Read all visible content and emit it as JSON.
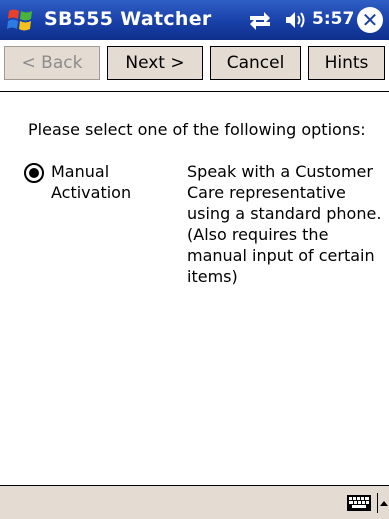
{
  "titlebar": {
    "app_title": "SB555 Watcher",
    "clock": "5:57",
    "close_glyph": "✕",
    "start_icon": "windows-flag-icon",
    "status_icons": [
      "connectivity-icon",
      "volume-icon"
    ],
    "color": "#1840a8"
  },
  "toolbar": {
    "back_label": "< Back",
    "next_label": "Next >",
    "cancel_label": "Cancel",
    "hints_label": "Hints"
  },
  "content": {
    "prompt": "Please select one of the following options:",
    "option": {
      "label": "Manual Activation",
      "selected": true,
      "description": "Speak with a Customer Care representative using a standard phone.  (Also requires the manual input of certain items)"
    }
  },
  "bottombar": {
    "icons": [
      "keyboard-icon",
      "input-menu-arrow-icon"
    ],
    "color": "#e4dbd3"
  }
}
